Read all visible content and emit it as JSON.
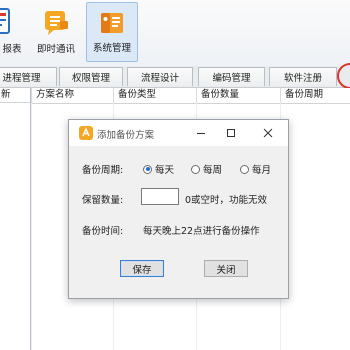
{
  "toolbar": {
    "items": [
      {
        "label": "报表",
        "icon": "report-icon"
      },
      {
        "label": "即时通讯",
        "icon": "chat-icon"
      },
      {
        "label": "系统管理",
        "icon": "system-manage-icon",
        "active": true
      }
    ]
  },
  "tabs": [
    {
      "label": "进程管理"
    },
    {
      "label": "权限管理"
    },
    {
      "label": "流程设计"
    },
    {
      "label": "编码管理"
    },
    {
      "label": "软件注册"
    }
  ],
  "left_pane": {
    "header": "新"
  },
  "grid": {
    "columns": [
      "方案名称",
      "备份类型",
      "备份数量",
      "备份周期"
    ]
  },
  "dialog": {
    "title": "添加备份方案",
    "cycle_label": "备份周期:",
    "cycle_options": [
      "每天",
      "每周",
      "每月"
    ],
    "cycle_selected": "每天",
    "keep_label": "保留数量:",
    "keep_value": "",
    "keep_hint": "0或空时，功能无效",
    "time_label": "备份时间:",
    "time_text": "每天晚上22点进行备份操作",
    "save_label": "保存",
    "close_label": "关闭"
  },
  "colors": {
    "accent": "#1a73d9",
    "highlight_ring": "#d9362b",
    "active_tool_bg": "#dbe8f6"
  }
}
